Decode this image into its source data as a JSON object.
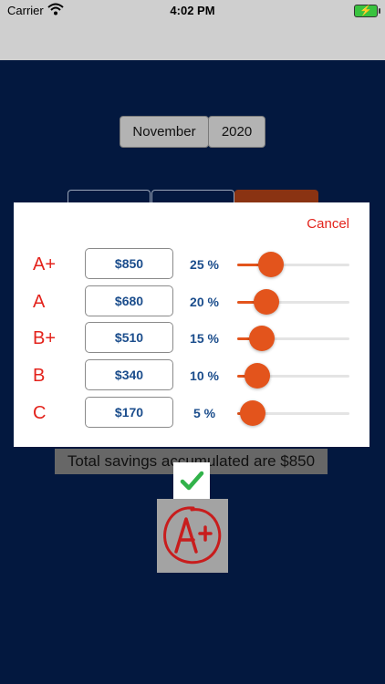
{
  "status_bar": {
    "carrier": "Carrier",
    "time": "4:02 PM"
  },
  "date_picker": {
    "month": "November",
    "year": "2020"
  },
  "modal": {
    "cancel_label": "Cancel",
    "rows": [
      {
        "grade": "A+",
        "amount": "$850",
        "percent_label": "25 %",
        "slider_value": 0.3
      },
      {
        "grade": "A",
        "amount": "$680",
        "percent_label": "20 %",
        "slider_value": 0.26
      },
      {
        "grade": "B+",
        "amount": "$510",
        "percent_label": "15 %",
        "slider_value": 0.22
      },
      {
        "grade": "B",
        "amount": "$340",
        "percent_label": "10 %",
        "slider_value": 0.18
      },
      {
        "grade": "C",
        "amount": "$170",
        "percent_label": "5 %",
        "slider_value": 0.14
      }
    ]
  },
  "savings": {
    "text": "Total savings accumulated are $850"
  },
  "colors": {
    "accent": "#e3541c",
    "grade_red": "#e3231c",
    "value_blue": "#1b4d8c",
    "background_navy": "#03183f"
  },
  "icons": {
    "check": "checkmark-icon",
    "grade_image": "a-plus-grade-icon"
  }
}
